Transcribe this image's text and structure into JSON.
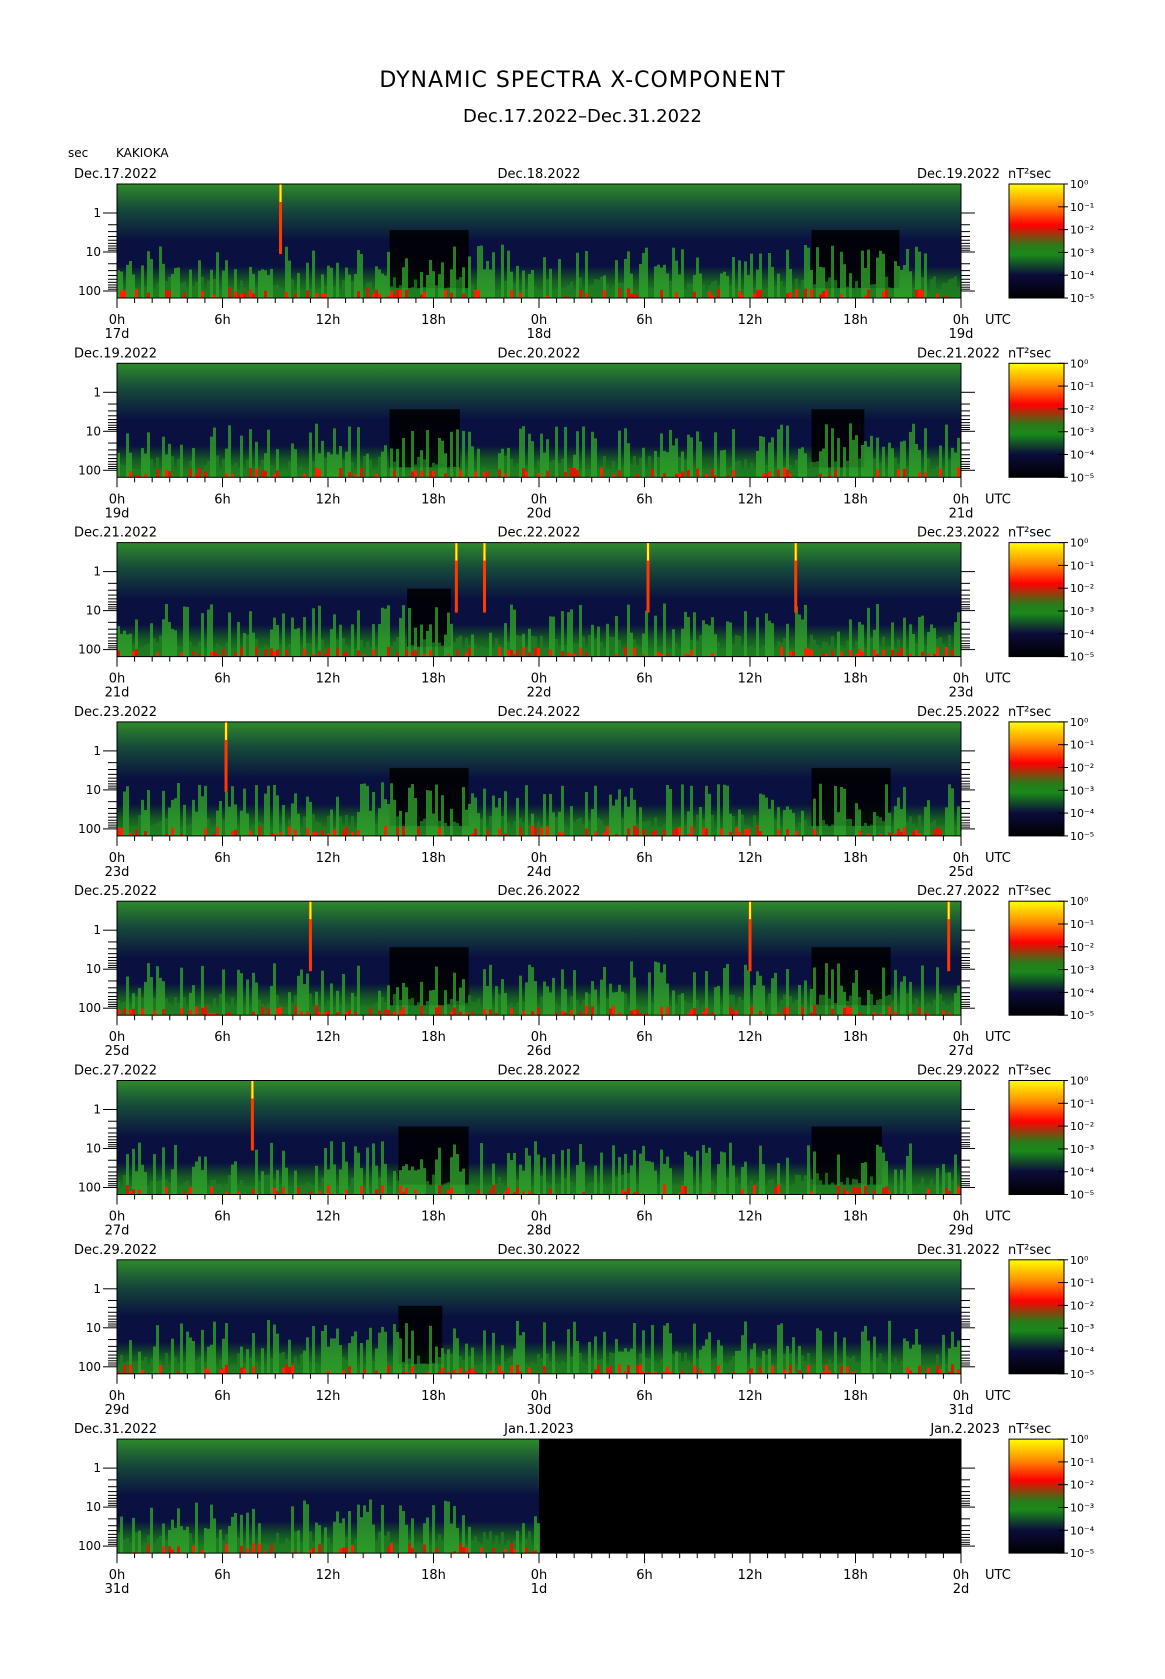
{
  "title": "DYNAMIC SPECTRA X-COMPONENT",
  "subtitle": "Dec.17.2022–Dec.31.2022",
  "station_label": "KAKIOKA",
  "y_unit_label": "sec",
  "colorbar_unit_label": "nT²sec",
  "chart_data": {
    "type": "heatmap",
    "component": "X",
    "y_ticks": [
      "1",
      "10",
      "100"
    ],
    "y_scale": "log",
    "colorbar": {
      "scale": "log",
      "ticks": [
        "10⁰",
        "10⁻¹",
        "10⁻²",
        "10⁻³",
        "10⁻⁴",
        "10⁻⁵"
      ],
      "colors": [
        "#ffff00",
        "#ff8000",
        "#ff0000",
        "#208020",
        "#00ff00",
        "#0b0c3a",
        "#000000"
      ]
    },
    "x_ticks": [
      "0h",
      "6h",
      "12h",
      "18h",
      "0h",
      "6h",
      "12h",
      "18h",
      "0h"
    ],
    "x_unit": "UTC",
    "panels": [
      {
        "start_date": "Dec.17.2022",
        "mid_date": "Dec.18.2022",
        "end_date": "Dec.19.2022",
        "day_labels": [
          "17d",
          "18d",
          "19d"
        ],
        "spikes_h": [
          9.3
        ],
        "quiet_h": [
          [
            15.5,
            20
          ],
          [
            39.5,
            44.5
          ]
        ],
        "data_end_h": 48
      },
      {
        "start_date": "Dec.19.2022",
        "mid_date": "Dec.20.2022",
        "end_date": "Dec.21.2022",
        "day_labels": [
          "19d",
          "20d",
          "21d"
        ],
        "spikes_h": [],
        "quiet_h": [
          [
            15.5,
            19.5
          ],
          [
            39.5,
            42.5
          ]
        ],
        "data_end_h": 48
      },
      {
        "start_date": "Dec.21.2022",
        "mid_date": "Dec.22.2022",
        "end_date": "Dec.23.2022",
        "day_labels": [
          "21d",
          "22d",
          "23d"
        ],
        "spikes_h": [
          19.3,
          20.9,
          30.2,
          38.6
        ],
        "quiet_h": [
          [
            16.5,
            19
          ]
        ],
        "data_end_h": 48
      },
      {
        "start_date": "Dec.23.2022",
        "mid_date": "Dec.24.2022",
        "end_date": "Dec.25.2022",
        "day_labels": [
          "23d",
          "24d",
          "25d"
        ],
        "spikes_h": [
          6.2
        ],
        "quiet_h": [
          [
            15.5,
            20
          ],
          [
            39.5,
            44
          ]
        ],
        "data_end_h": 48
      },
      {
        "start_date": "Dec.25.2022",
        "mid_date": "Dec.26.2022",
        "end_date": "Dec.27.2022",
        "day_labels": [
          "25d",
          "26d",
          "27d"
        ],
        "spikes_h": [
          11.0,
          36.0,
          47.3
        ],
        "quiet_h": [
          [
            15.5,
            20
          ],
          [
            39.5,
            44
          ]
        ],
        "data_end_h": 48
      },
      {
        "start_date": "Dec.27.2022",
        "mid_date": "Dec.28.2022",
        "end_date": "Dec.29.2022",
        "day_labels": [
          "27d",
          "28d",
          "29d"
        ],
        "spikes_h": [
          7.7
        ],
        "quiet_h": [
          [
            16,
            20
          ],
          [
            39.5,
            43.5
          ]
        ],
        "data_end_h": 48
      },
      {
        "start_date": "Dec.29.2022",
        "mid_date": "Dec.30.2022",
        "end_date": "Dec.31.2022",
        "day_labels": [
          "29d",
          "30d",
          "31d"
        ],
        "spikes_h": [],
        "quiet_h": [
          [
            16,
            18.5
          ]
        ],
        "data_end_h": 48
      },
      {
        "start_date": "Dec.31.2022",
        "mid_date": "Jan.1.2023",
        "end_date": "Jan.2.2023",
        "day_labels": [
          "31d",
          "1d",
          "2d"
        ],
        "spikes_h": [],
        "quiet_h": [],
        "data_end_h": 24
      }
    ]
  }
}
